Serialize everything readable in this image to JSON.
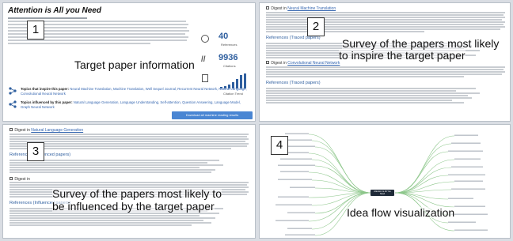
{
  "panel1": {
    "number": "1",
    "paper_title": "Attention is All you Need",
    "caption": "Target paper information",
    "stats": [
      {
        "value": "40",
        "label": "References"
      },
      {
        "value": "9936",
        "label": "Citations"
      },
      {
        "value": "",
        "label": "Citation Trend"
      }
    ],
    "inspire_label": "Topics that inspire this paper:",
    "inspire_topics": "Neural Machine Translation, Machine Translation, Well Sequel Journal, Recurrent Neural Network, Natural Language, Convolutional Neural Network",
    "influenced_label": "Topics influenced by this paper:",
    "influenced_topics": "Natural Language Generation, Language Understanding, Self-attention, Question Answering, Language Model, Graph Neural Network",
    "download_button": "Download all machine reading results"
  },
  "panel2": {
    "number": "2",
    "digest_prefix": "Digest in",
    "digest_topic": "Neural Machine Translation",
    "references_header": "References (Traced papers)",
    "digest2_prefix": "Digest in",
    "digest2_topic": "Convolutional Neural Network",
    "caption_line1": "Survey of the papers most likely",
    "caption_line2": "to inspire the target paper"
  },
  "panel3": {
    "number": "3",
    "digest_prefix": "Digest in",
    "digest_topic": "Natural Language Generation",
    "references_header": "References (Influenced papers)",
    "digest2_prefix": "Digest in",
    "caption_line1": "Survey of the papers most likely to",
    "caption_line2": "be influenced by the target paper"
  },
  "panel4": {
    "number": "4",
    "center_node": "Attention Is All You Need",
    "caption": "Idea flow visualization"
  },
  "colors": {
    "accent": "#2f5f9f",
    "button": "#4a86d3",
    "center_node": "#1f2a38",
    "mindmap_branch": "#8cc68a"
  }
}
